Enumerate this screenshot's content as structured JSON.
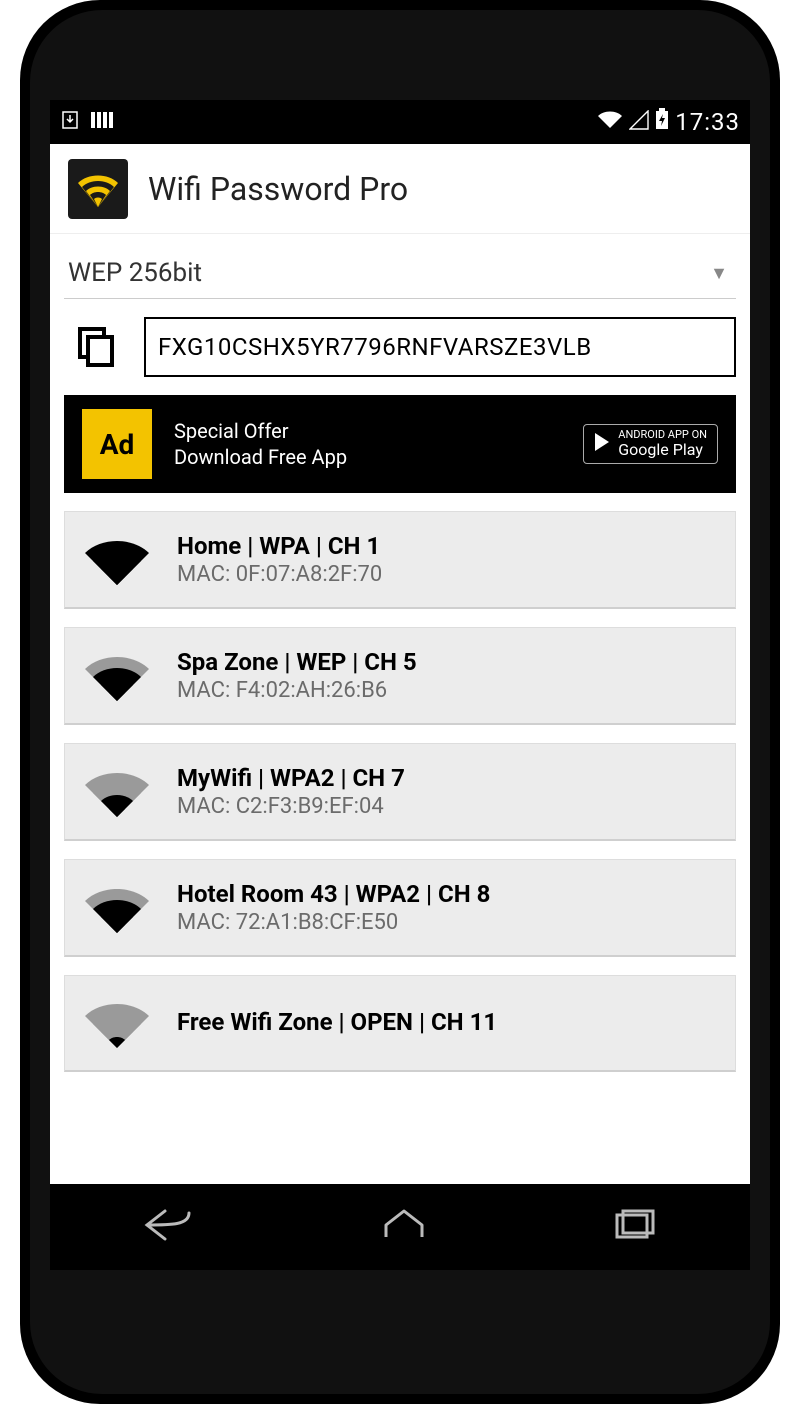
{
  "status": {
    "time": "17:33"
  },
  "app": {
    "title": "Wifi Password Pro"
  },
  "encryption": {
    "selected": "WEP 256bit"
  },
  "password": {
    "value": "FXG10CSHX5YR7796RNFVARSZE3VLB"
  },
  "ad": {
    "badge": "Ad",
    "line1": "Special Offer",
    "line2": "Download Free App",
    "store_small": "ANDROID APP ON",
    "store_big": "Google Play"
  },
  "networks": [
    {
      "title": "Home | WPA | CH 1",
      "mac": "MAC: 0F:07:A8:2F:70",
      "strength": 4
    },
    {
      "title": "Spa Zone | WEP | CH 5",
      "mac": "MAC: F4:02:AH:26:B6",
      "strength": 3
    },
    {
      "title": "MyWifi | WPA2 | CH 7",
      "mac": "MAC: C2:F3:B9:EF:04",
      "strength": 2
    },
    {
      "title": "Hotel Room 43 | WPA2 | CH 8",
      "mac": "MAC: 72:A1:B8:CF:E50",
      "strength": 3
    },
    {
      "title": "Free Wifi Zone | OPEN | CH 11",
      "mac": "",
      "strength": 1
    }
  ]
}
